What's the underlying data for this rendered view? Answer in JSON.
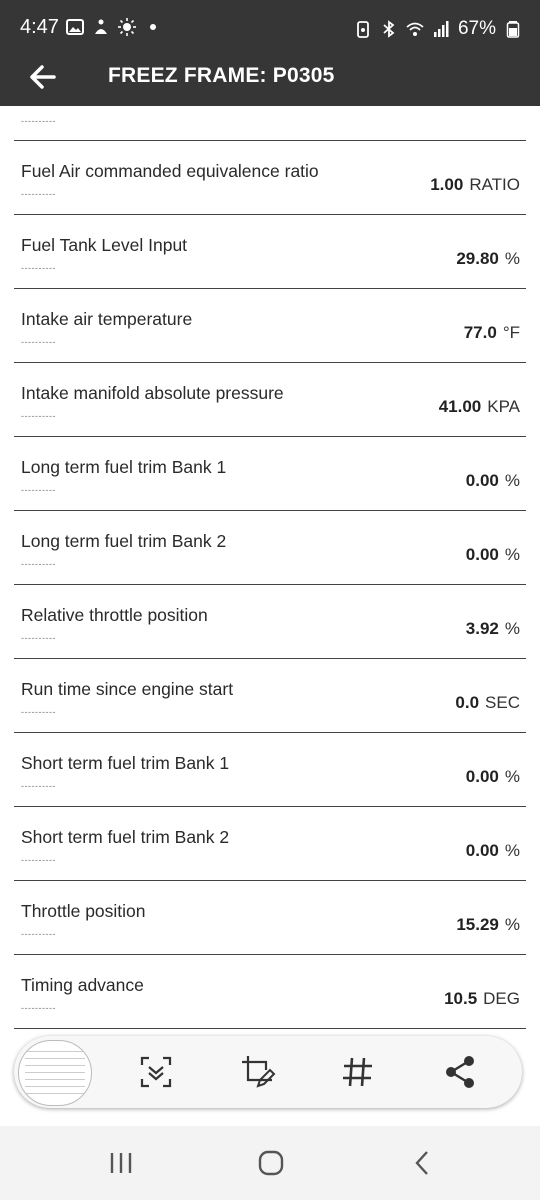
{
  "status_bar": {
    "time": "4:47",
    "battery": "67%"
  },
  "app_bar": {
    "back_icon": "arrow-left-icon",
    "title": "FREEZ FRAME: P0305"
  },
  "list": {
    "partial_dash": "----------",
    "rows": [
      {
        "label": "Fuel Air commanded equivalence ratio",
        "dash": "----------",
        "value": "1.00",
        "unit": "RATIO"
      },
      {
        "label": "Fuel Tank Level Input",
        "dash": "----------",
        "value": "29.80",
        "unit": "%"
      },
      {
        "label": "Intake air temperature",
        "dash": "----------",
        "value": "77.0",
        "unit": "°F"
      },
      {
        "label": "Intake manifold absolute pressure",
        "dash": "----------",
        "value": "41.00",
        "unit": "KPA"
      },
      {
        "label": "Long term fuel trim Bank 1",
        "dash": "----------",
        "value": "0.00",
        "unit": "%"
      },
      {
        "label": "Long term fuel trim Bank 2",
        "dash": "----------",
        "value": "0.00",
        "unit": "%"
      },
      {
        "label": "Relative throttle position",
        "dash": "----------",
        "value": "3.92",
        "unit": "%"
      },
      {
        "label": "Run time since engine start",
        "dash": "----------",
        "value": "0.0",
        "unit": "SEC"
      },
      {
        "label": "Short term fuel trim Bank 1",
        "dash": "----------",
        "value": "0.00",
        "unit": "%"
      },
      {
        "label": "Short term fuel trim Bank 2",
        "dash": "----------",
        "value": "0.00",
        "unit": "%"
      },
      {
        "label": "Throttle position",
        "dash": "----------",
        "value": "15.29",
        "unit": "%"
      },
      {
        "label": "Timing advance",
        "dash": "----------",
        "value": "10.5",
        "unit": "DEG"
      }
    ]
  },
  "toolbar": {
    "icons": [
      "screenshot-thumbnail",
      "scroll-capture-icon",
      "crop-edit-icon",
      "hashtag-icon",
      "share-icon"
    ]
  },
  "nav_bar": {
    "icons": [
      "recent-apps-icon",
      "home-icon",
      "back-icon"
    ]
  },
  "colors": {
    "header_bg": "#363636",
    "divider": "#444444",
    "toolbar_bg": "#f7f7f7",
    "nav_bg": "#f3f3f3"
  }
}
